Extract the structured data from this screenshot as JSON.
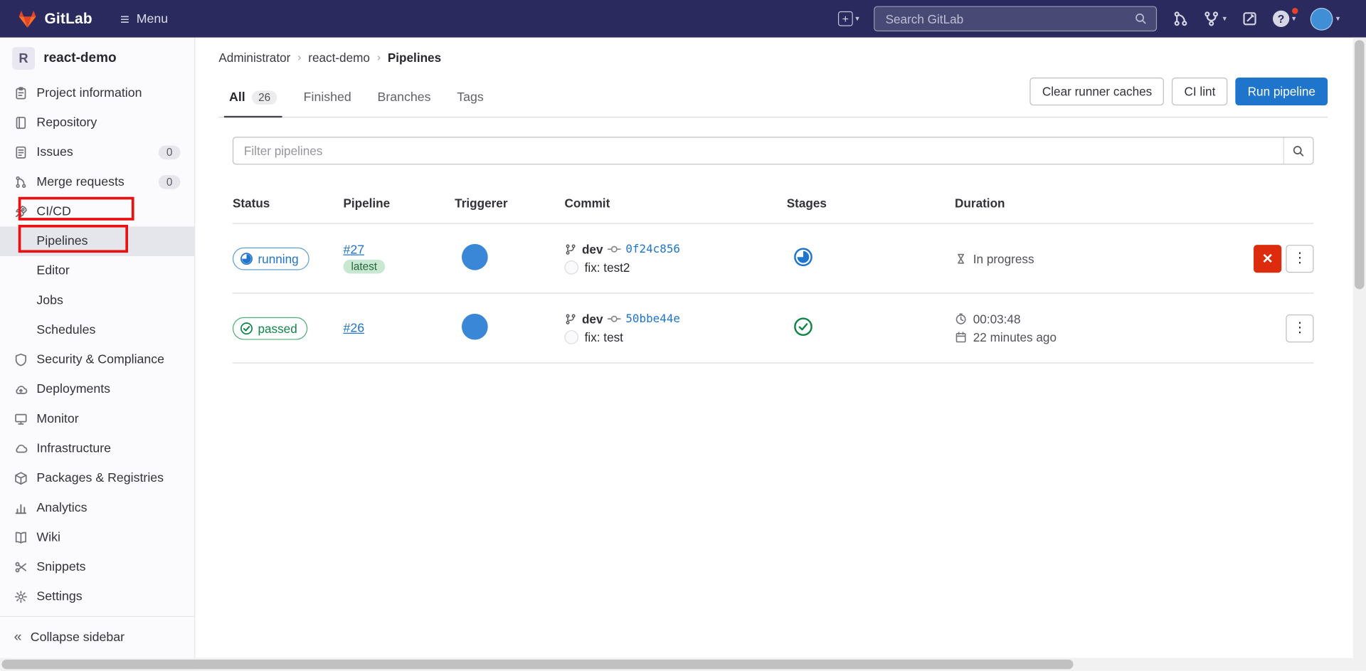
{
  "navbar": {
    "brand": "GitLab",
    "menu_label": "Menu",
    "search_placeholder": "Search GitLab"
  },
  "sidebar": {
    "project_initial": "R",
    "project_name": "react-demo",
    "items": {
      "project_information": "Project information",
      "repository": "Repository",
      "issues": "Issues",
      "issues_badge": "0",
      "merge_requests": "Merge requests",
      "merge_requests_badge": "0",
      "ci_cd": "CI/CD",
      "pipelines": "Pipelines",
      "editor": "Editor",
      "jobs": "Jobs",
      "schedules": "Schedules",
      "security": "Security & Compliance",
      "deployments": "Deployments",
      "monitor": "Monitor",
      "infrastructure": "Infrastructure",
      "packages": "Packages & Registries",
      "analytics": "Analytics",
      "wiki": "Wiki",
      "snippets": "Snippets",
      "settings": "Settings"
    },
    "collapse_label": "Collapse sidebar"
  },
  "breadcrumb": {
    "root": "Administrator",
    "project": "react-demo",
    "current": "Pipelines"
  },
  "tabs": {
    "all": "All",
    "all_count": "26",
    "finished": "Finished",
    "branches": "Branches",
    "tags": "Tags"
  },
  "actions": {
    "clear_caches": "Clear runner caches",
    "ci_lint": "CI lint",
    "run_pipeline": "Run pipeline"
  },
  "filter": {
    "placeholder": "Filter pipelines"
  },
  "table": {
    "headers": {
      "status": "Status",
      "pipeline": "Pipeline",
      "triggerer": "Triggerer",
      "commit": "Commit",
      "stages": "Stages",
      "duration": "Duration"
    },
    "rows": [
      {
        "status": "running",
        "id": "#27",
        "latest": "latest",
        "branch": "dev",
        "sha": "0f24c856",
        "message": "fix: test2",
        "duration": "In progress"
      },
      {
        "status": "passed",
        "id": "#26",
        "branch": "dev",
        "sha": "50bbe44e",
        "message": "fix: test",
        "duration": "00:03:48",
        "when": "22 minutes ago"
      }
    ]
  },
  "colors": {
    "navbar_bg": "#2a2a5e",
    "accent_blue": "#1f75cb",
    "success_green": "#108548",
    "danger_red": "#dd2b0e",
    "latest_badge_bg": "#c9e8d2",
    "annotation_red": "#e81010"
  }
}
